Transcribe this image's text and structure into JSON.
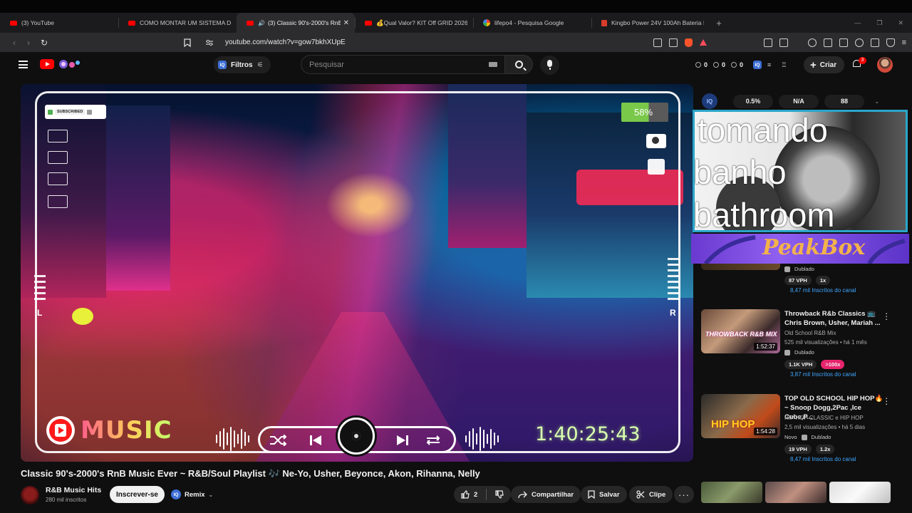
{
  "browser": {
    "tabs": [
      {
        "title": "(3) YouTube",
        "active": false,
        "icon": "youtube-icon"
      },
      {
        "title": "COMO MONTAR UM SISTEMA DE EN",
        "active": false,
        "icon": "youtube-icon"
      },
      {
        "title": "(3) Classic 90's-2000's RnB M",
        "active": true,
        "icon": "youtube-icon",
        "audio": true
      },
      {
        "title": "💰Qual Valor? KIT Off GRID 2026 🔋⚡",
        "active": false,
        "icon": "youtube-icon"
      },
      {
        "title": "lifepo4 - Pesquisa Google",
        "active": false,
        "icon": "google-icon"
      },
      {
        "title": "Kingbo Power 24V 100Ah Bateria Lít",
        "active": false,
        "icon": "kingbo-icon"
      }
    ],
    "new_tab": "+",
    "url": "youtube.com/watch?v=gow7bkhXUpE"
  },
  "youtube_header": {
    "filters_label": "Filtros",
    "search_placeholder": "Pesquisar",
    "stats": [
      "0",
      "0",
      "0"
    ],
    "create_label": "Criar",
    "notifications_count": "3"
  },
  "player": {
    "subscribed_label": "SUBSCRIBED",
    "volume_percent": "58%",
    "volume_level": 0.58,
    "left_channel": "L",
    "right_channel": "R",
    "brand_word": "MUSIC",
    "timer": "1:40:25:43"
  },
  "video": {
    "title": "Classic 90's-2000's RnB Music Ever ~ R&B/Soul Playlist 🎶 Ne-Yo, Usher, Beyonce, Akon, Rihanna, Nelly",
    "channel_name": "R&B Music Hits",
    "channel_subs": "280 mil inscritos",
    "subscribe_label": "Inscrever-se",
    "remix_label": "Remix",
    "likes": "2",
    "share_label": "Compartilhar",
    "save_label": "Salvar",
    "clip_label": "Clipe"
  },
  "iq_panel": {
    "logo": "IQ",
    "stats": [
      "0.5%",
      "N/A",
      "88"
    ]
  },
  "webcam_overlay": {
    "caption_lines": [
      "tomando",
      "banho",
      "bathroom"
    ],
    "banner_text": "PeakBox"
  },
  "recommendations": [
    {
      "partial": true,
      "dubbed_label": "Dublado",
      "vph": "87 VPH",
      "multiplier": "1x",
      "channel_subs": "8,47 mil Inscritos do canal"
    },
    {
      "title": "Throwback R&b Classics 📺 Chris Brown, Usher, Mariah ...",
      "channel": "Old School R&B Mix",
      "meta": "525 mil visualizações • há 1 mês",
      "duration": "1:52:37",
      "dubbed_label": "Dublado",
      "vph": "1.1K VPH",
      "multiplier": ">100x",
      "channel_subs": "3,87 mil Inscritos do canal",
      "thumb_text": "THROWBACK R&B MIX"
    },
    {
      "title": "TOP OLD SCHOOL HIP HOP🔥~ Snoop Dogg,2Pac ,Ice Cube,P...",
      "channel": "HIP HOP CLASSIC e HIP HOP",
      "meta": "2,5 mil visualizações • há 5 dias",
      "new_label": "Novo",
      "duration": "1:54:28",
      "dubbed_label": "Dublado",
      "vph": "19 VPH",
      "multiplier": "1.2x",
      "channel_subs": "8,47 mil Inscritos do canal",
      "thumb_text": "HIP HOP"
    }
  ]
}
